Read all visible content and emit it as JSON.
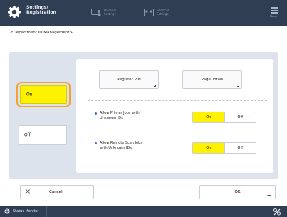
{
  "header": {
    "title_line1": "Settings/",
    "title_line2": "Registration",
    "btn1_line1": "Personal",
    "btn1_line2": "Settings",
    "btn2_line1": "Shortcut",
    "btn2_line2": "Settings",
    "menu_label": "Menu"
  },
  "breadcrumb": "<Department ID Management>",
  "mode": {
    "on_label": "On",
    "off_label": "Off",
    "selected": "On"
  },
  "settings": {
    "register_pin_label": "Register PIN",
    "page_totals_label": "Page Totals",
    "options": [
      {
        "line1": "Allow Printer Jobs with",
        "line2": "Unknown IDs",
        "on": "On",
        "off": "Off",
        "selected": "On"
      },
      {
        "line1": "Allow Remote Scan Jobs",
        "line2": "with Unknown IDs",
        "on": "On",
        "off": "Off",
        "selected": "On"
      }
    ]
  },
  "footer": {
    "cancel_label": "Cancel",
    "ok_label": "OK"
  },
  "statusbar": {
    "status_monitor_label": "Status Monitor"
  },
  "colors": {
    "header_bg": "#2f3e52",
    "panel_bg": "#dde3ec",
    "selected_yellow": "#fff200",
    "focus_orange": "#f2a233"
  }
}
